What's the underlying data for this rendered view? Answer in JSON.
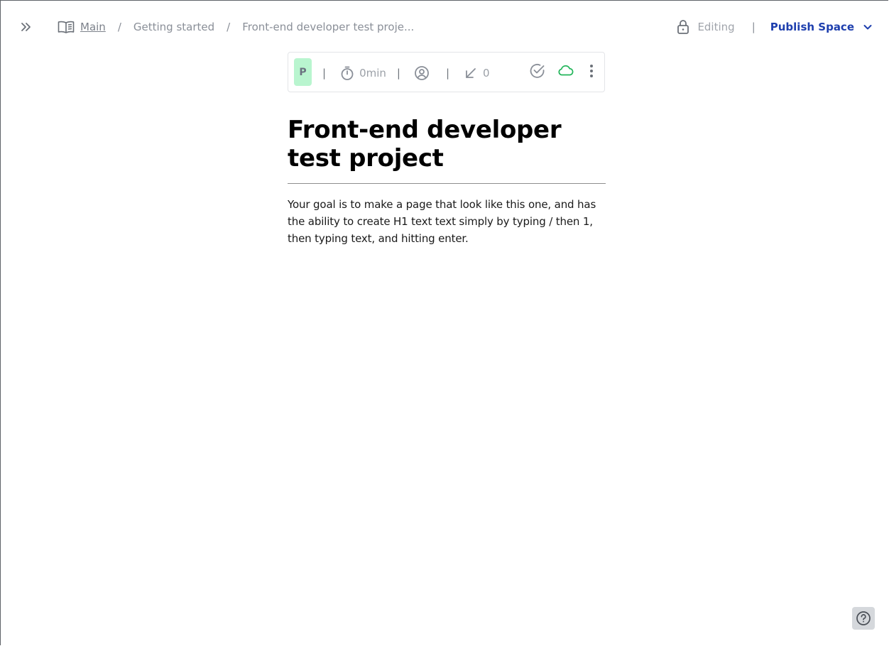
{
  "breadcrumb": {
    "items": [
      "Main",
      "Getting started",
      "Front-end developer test proje..."
    ],
    "separator": "/"
  },
  "header": {
    "mode_label": "Editing",
    "divider": "|",
    "publish_label": "Publish Space"
  },
  "info_bar": {
    "avatar_letter": "P",
    "divider": "|",
    "read_time": "0min",
    "backlinks_count": "0"
  },
  "document": {
    "title": "Front-end developer test project",
    "body": "Your goal is to make a page that look like this one, and has the ability to create H1 text text simply by typing / then 1, then typing text, and hitting enter."
  },
  "icons": {
    "expand": "double-chevron-right-icon",
    "book": "open-book-icon",
    "lock": "lock-icon",
    "publish_menu": "chevron-down-icon",
    "timer": "stopwatch-icon",
    "user": "user-circle-icon",
    "backlinks": "arrow-down-left-icon",
    "check": "check-circle-icon",
    "sync": "cloud-icon",
    "more": "more-vertical-icon",
    "help": "help-circle-icon"
  },
  "colors": {
    "accent": "#1e3fae",
    "avatar_bg": "#b9f5cf",
    "cloud_green": "#22b55a",
    "muted": "#8a8f98"
  }
}
